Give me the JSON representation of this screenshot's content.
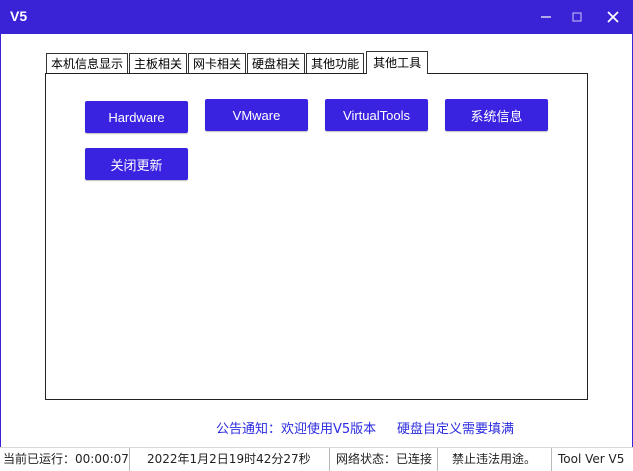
{
  "window": {
    "title": "V5",
    "minimize_glyph": "–",
    "maximize_glyph": "□",
    "close_glyph": "✕"
  },
  "tabs": [
    {
      "label": "本机信息显示"
    },
    {
      "label": "主板相关"
    },
    {
      "label": "网卡相关"
    },
    {
      "label": "硬盘相关"
    },
    {
      "label": "其他功能"
    },
    {
      "label": "其他工具",
      "active": true
    }
  ],
  "buttons": {
    "hardware": "Hardware",
    "vmware": "VMware",
    "virtualtools": "VirtualTools",
    "sysinfo": "系统信息",
    "close_update": "关闭更新"
  },
  "notice": {
    "announcement": "公告通知：欢迎使用V5版本",
    "disk_hint": "硬盘自定义需要填满"
  },
  "status": {
    "uptime": "当前已运行：00:00:07",
    "datetime": "2022年1月2日19时42分27秒",
    "network": "网络状态：已连接",
    "warning": "禁止违法用途。",
    "version": "Tool Ver V5"
  },
  "colors": {
    "accent": "#3a23d7",
    "button": "#3a23e0",
    "notice_text": "#2a2ae0"
  }
}
